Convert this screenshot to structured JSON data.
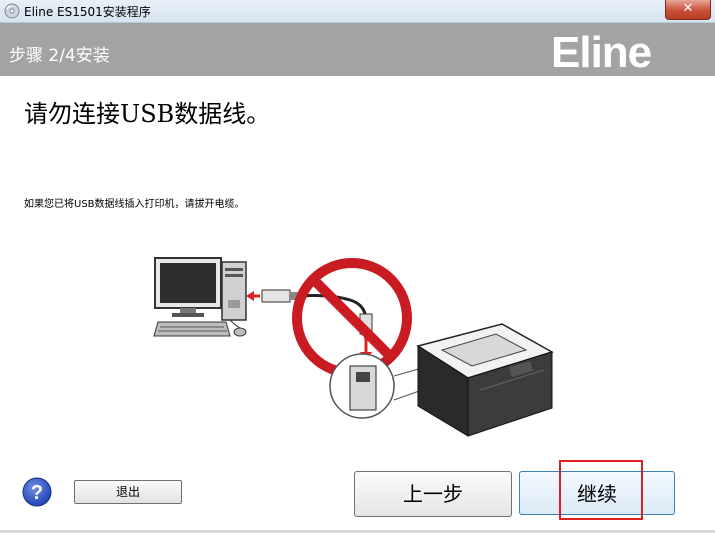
{
  "window": {
    "title": "Eline ES1501安装程序",
    "close_label": "✕"
  },
  "header": {
    "step_label": "步骤 2/4安装",
    "logo_text": "Eline",
    "background_color": "#a3a3a3"
  },
  "main": {
    "heading": "请勿连接USB数据线。",
    "instruction": "如果您已将USB数据线插入打印机，请拔开电缆。"
  },
  "footer": {
    "help_icon": "question-mark-icon",
    "exit_label": "退出",
    "back_label": "上一步",
    "continue_label": "继续",
    "highlight_color": "#e02020"
  }
}
